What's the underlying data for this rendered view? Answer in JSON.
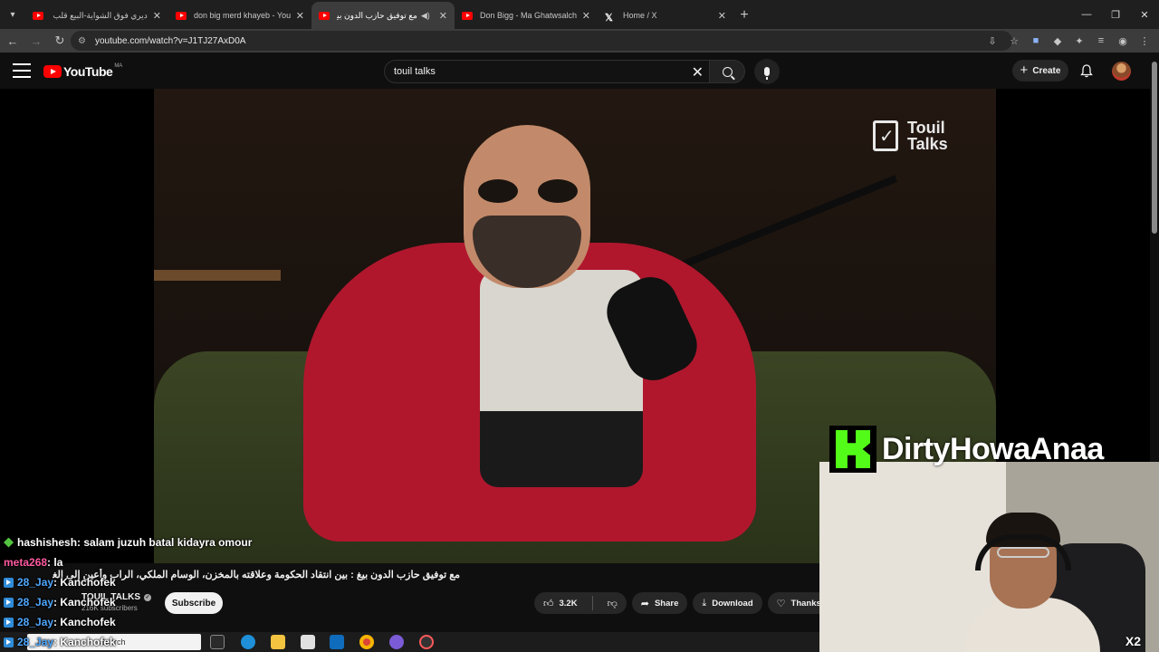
{
  "browser": {
    "tabs": [
      {
        "title": "ديري فوق الشواية-البيع قلب الطا",
        "rtl": true,
        "active": false
      },
      {
        "title": "don big merd khayeb - YouTube",
        "rtl": false,
        "active": false
      },
      {
        "title": "مع توفيق حازب الدون بيغ : بي",
        "rtl": true,
        "active": true
      },
      {
        "title": "Don Bigg - Ma Ghatwsalch (Offi",
        "rtl": false,
        "active": false
      },
      {
        "title": "Home / X",
        "rtl": false,
        "active": false
      }
    ],
    "url": "youtube.com/watch?v=J1TJ27AxD0A"
  },
  "youtube": {
    "logo_text": "YouTube",
    "country_code": "MA",
    "search_query": "touil talks",
    "create_label": "Create"
  },
  "video": {
    "channel_watermark_line1": "Touil",
    "channel_watermark_line2": "Talks",
    "title": "مع توفيق حازب الدون بيغ : بين انتقاد الحكومة وعلاقته بالمخزن، الوسام الملكي، الراب وأعين إلى الغلاقات",
    "channel_name": "TOUIL TALKS",
    "subscribers": "216K subscribers",
    "subscribe_label": "Subscribe",
    "like_count": "3.2K",
    "share_label": "Share",
    "download_label": "Download",
    "thanks_label": "Thanks"
  },
  "chat": [
    {
      "user": "hashishesh",
      "text": " : salam juzuh batal kidayra omour",
      "badge": "green",
      "color": "white"
    },
    {
      "user": "meta268",
      "text": " : la",
      "badge": "",
      "color": "pink"
    },
    {
      "user": "28_Jay",
      "text": " : Kanchofek",
      "badge": "blue",
      "color": "blue"
    },
    {
      "user": "28_Jay",
      "text": " : Kanchofek",
      "badge": "blue",
      "color": "blue"
    },
    {
      "user": "28_Jay",
      "text": " : Kanchofek",
      "badge": "blue",
      "color": "blue"
    },
    {
      "user": "28_Jay",
      "text": " : Kanchofek",
      "badge": "blue",
      "color": "blue"
    }
  ],
  "stream": {
    "streamer_name": "DirtyHowaAnaa",
    "multiplier": "X2",
    "kick_color": "#53fc18"
  },
  "taskbar": {
    "search_placeholder": "Search"
  }
}
